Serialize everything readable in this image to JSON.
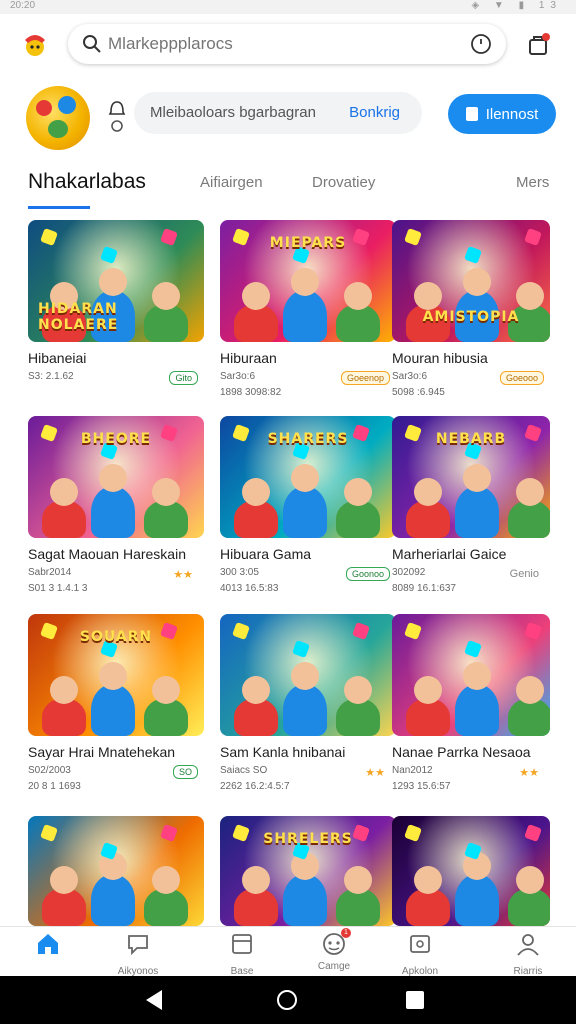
{
  "status_bar": {
    "time": "20:20",
    "icons": "◈ ▼ ▮ 13"
  },
  "search": {
    "placeholder": "Mlarkeppplarocs",
    "value": ""
  },
  "promo": {
    "text": "Mleibaoloars bgarbagran",
    "link": "Bonkrig",
    "button": "Ilennost"
  },
  "tabs": [
    {
      "label": "Nhakarlabas",
      "active": true
    },
    {
      "label": "Aifiairgen",
      "active": false
    },
    {
      "label": "Drovatiey",
      "active": false
    },
    {
      "label": "Mers",
      "active": false
    }
  ],
  "games": [
    {
      "title": "Hibaneiai",
      "meta1": "S3: 2.1.62",
      "meta2": "",
      "badge": "Gito",
      "badge_style": "green",
      "art_text": "HIDARAN NOLAERE",
      "colors": [
        "#0f4c81",
        "#2e8b57",
        "#f4a300"
      ]
    },
    {
      "title": "Hiburaan",
      "meta1": "Sar3o:6",
      "meta2": "1898 3098:82",
      "badge": "Goeenop",
      "badge_style": "orange",
      "art_text": "MIEPARS",
      "colors": [
        "#7b1fa2",
        "#e91e63",
        "#ffb300"
      ]
    },
    {
      "title": "Mouran hibusia",
      "meta1": "Sar3o:6",
      "meta2": "5098 :6.945",
      "badge": "Goeooo",
      "badge_style": "orange",
      "art_text": "AMISTOPIA",
      "colors": [
        "#4a148c",
        "#c2185b",
        "#ff7043"
      ]
    },
    {
      "title": "Sagat Maouan Hareskain",
      "meta1": "Sabr2014",
      "meta2": "S01 3 1.4.1 3",
      "badge": "★★",
      "badge_style": "stars",
      "art_text": "BHEORE",
      "colors": [
        "#6a1b9a",
        "#f06292",
        "#ffd54f"
      ]
    },
    {
      "title": "Hibuara Gama",
      "meta1": "300 3:05",
      "meta2": "4013 16.5:83",
      "badge": "Goonoo",
      "badge_style": "green",
      "art_text": "SHARERS",
      "colors": [
        "#0d47a1",
        "#00acc1",
        "#ffca28"
      ]
    },
    {
      "title": "Marheriarlai Gaice",
      "meta1": "302092",
      "meta2": "8089 16.1:637",
      "badge": "Genio",
      "badge_style": "plain",
      "art_text": "NEBARB",
      "colors": [
        "#311b92",
        "#8e24aa",
        "#ffb300"
      ]
    },
    {
      "title": "Sayar Hrai Mnatehekan",
      "meta1": "S02/2003",
      "meta2": "20 8 1 1693",
      "badge": "SO",
      "badge_style": "green",
      "art_text": "SOUARN",
      "colors": [
        "#bf360c",
        "#ff8f00",
        "#ffee58"
      ]
    },
    {
      "title": "Sam Kanla hnibanai",
      "meta1": "Saiacs SO",
      "meta2": "2262 16.2:4.5:7",
      "badge": "★★",
      "badge_style": "stars",
      "art_text": "",
      "colors": [
        "#1565c0",
        "#26a69a",
        "#ffd54f"
      ]
    },
    {
      "title": "Nanae Parrka Nesaoa",
      "meta1": "Nan2012",
      "meta2": "1293 15.6:57",
      "badge": "★★",
      "badge_style": "stars",
      "art_text": "",
      "colors": [
        "#6a1b9a",
        "#ec407a",
        "#29b6f6"
      ]
    },
    {
      "title": "",
      "meta1": "",
      "meta2": "",
      "badge": "",
      "badge_style": "plain",
      "art_text": "",
      "colors": [
        "#0277bd",
        "#ef6c00",
        "#fdd835"
      ]
    },
    {
      "title": "",
      "meta1": "",
      "meta2": "",
      "badge": "",
      "badge_style": "plain",
      "art_text": "SHRELERS",
      "colors": [
        "#1a237e",
        "#7b1fa2",
        "#ffca28"
      ]
    },
    {
      "title": "",
      "meta1": "",
      "meta2": "",
      "badge": "",
      "badge_style": "plain",
      "art_text": "",
      "colors": [
        "#1a0033",
        "#4a148c",
        "#e53935"
      ]
    }
  ],
  "bottom_nav": [
    {
      "label": "",
      "icon": "home-icon",
      "active": true
    },
    {
      "label": "Aikyonos",
      "icon": "chat-icon",
      "active": false
    },
    {
      "label": "Base",
      "icon": "library-icon",
      "active": false
    },
    {
      "label": "Camge",
      "icon": "games-icon",
      "active": false,
      "badge": "1"
    },
    {
      "label": "Apkolon",
      "icon": "apps-icon",
      "active": false
    },
    {
      "label": "Riarris",
      "icon": "profile-icon",
      "active": false
    }
  ],
  "accent_color": "#1a73e8"
}
